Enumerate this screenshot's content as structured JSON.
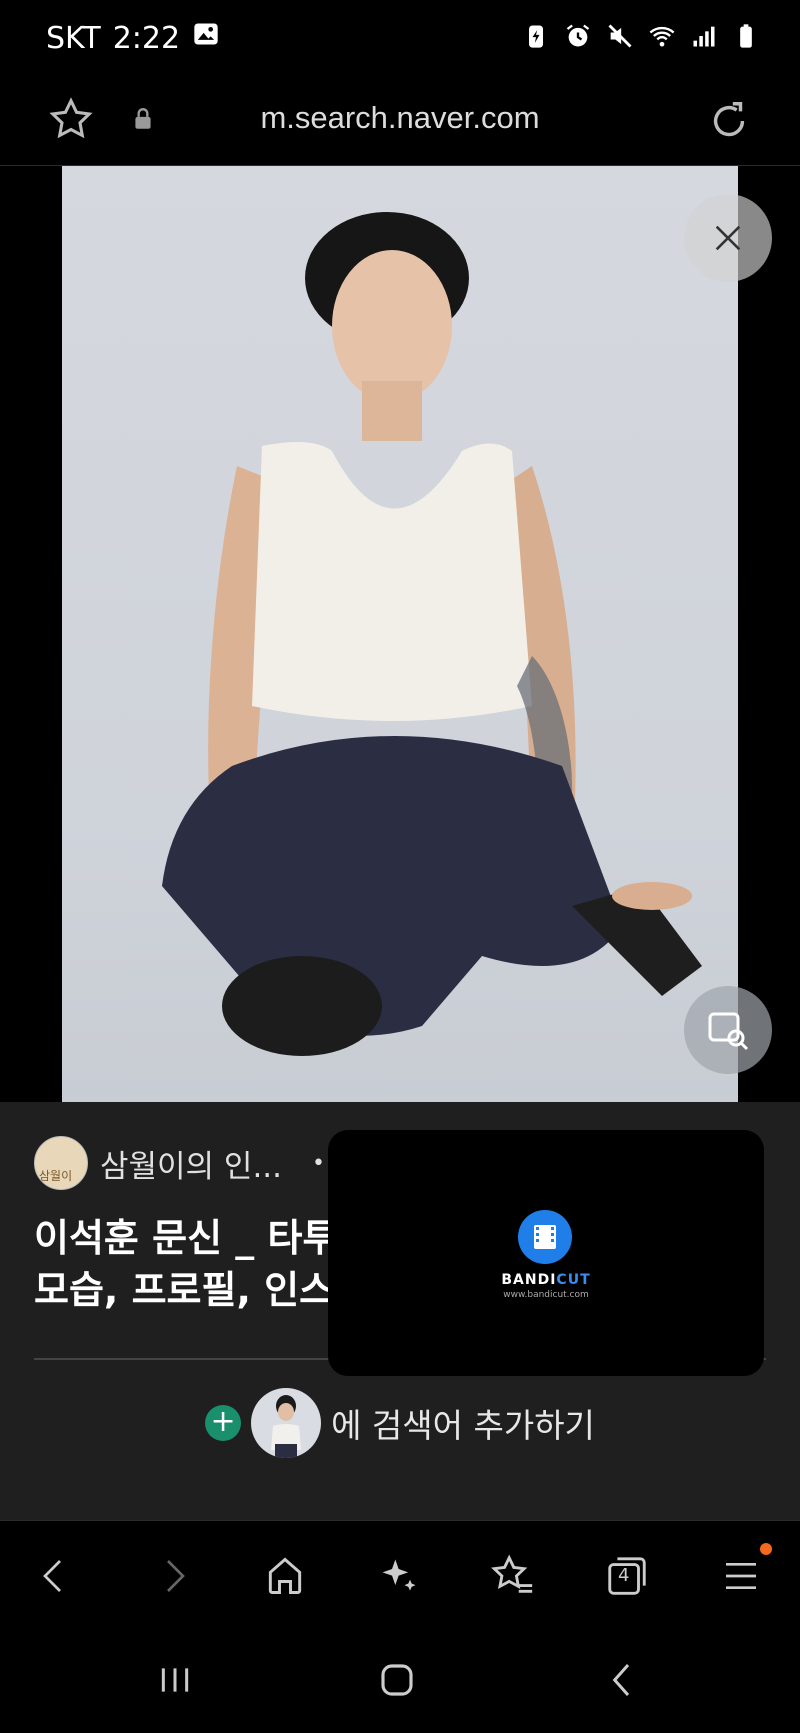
{
  "status_bar": {
    "carrier": "SKT",
    "time": "2:22"
  },
  "browser": {
    "url": "m.search.naver.com"
  },
  "result": {
    "source_name": "삼월이의 인...",
    "source_separator": "•",
    "avatar_label": "삼월이",
    "title_line1": "이석훈 문신 _ 타투",
    "title_line2": "모습, 프로필, 인스"
  },
  "add_search": {
    "text": "에 검색어 추가하기"
  },
  "overlay": {
    "brand_a": "BANDI",
    "brand_b": "CUT",
    "site": "www.bandicut.com"
  },
  "toolbar": {
    "tab_count": "4"
  },
  "colors": {
    "accent_green": "#1a8f6b",
    "notification": "#f56a1f",
    "bandicut_blue": "#1f7ee8"
  }
}
